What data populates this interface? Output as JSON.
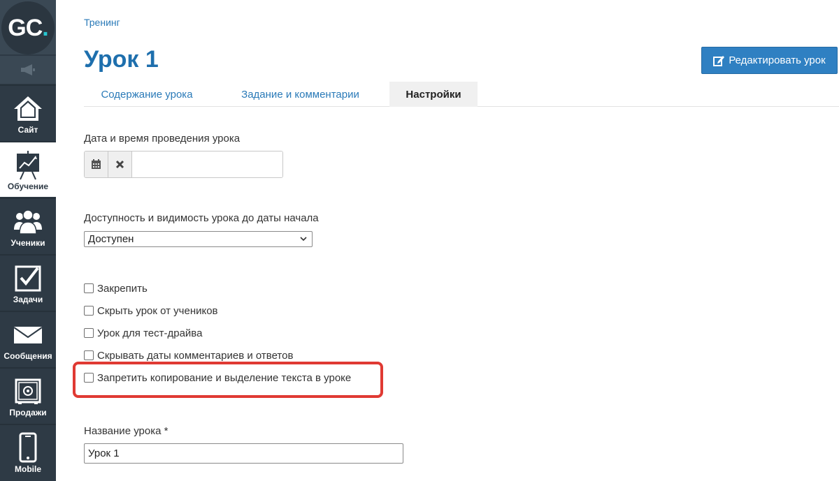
{
  "sidebar": {
    "logo": {
      "text": "GC",
      "dot": "."
    },
    "items": [
      {
        "label": "Сайт",
        "icon": "home-icon"
      },
      {
        "label": "Обучение",
        "icon": "training-chart-icon"
      },
      {
        "label": "Ученики",
        "icon": "users-icon"
      },
      {
        "label": "Задачи",
        "icon": "checkbox-icon"
      },
      {
        "label": "Сообщения",
        "icon": "envelope-icon"
      },
      {
        "label": "Продажи",
        "icon": "safe-icon"
      },
      {
        "label": "Mobile",
        "icon": "phone-icon"
      }
    ]
  },
  "header": {
    "breadcrumb": "Тренинг",
    "title": "Урок 1",
    "edit_button": "Редактировать урок"
  },
  "tabs": [
    {
      "label": "Содержание урока"
    },
    {
      "label": "Задание и комментарии"
    },
    {
      "label": "Настройки"
    }
  ],
  "form": {
    "date_label": "Дата и время проведения урока",
    "date_value": "",
    "availability_label": "Доступность и видимость урока до даты начала",
    "availability_selected": "Доступен",
    "checkboxes": [
      {
        "label": "Закрепить"
      },
      {
        "label": "Скрыть урок от учеников"
      },
      {
        "label": "Урок для тест-драйва"
      },
      {
        "label": "Скрывать даты комментариев и ответов"
      },
      {
        "label": "Запретить копирование и выделение текста в уроке"
      }
    ],
    "name_label": "Название урока *",
    "name_value": "Урок 1"
  },
  "colors": {
    "sidebar": "#2e3a45",
    "accent": "#2f80c2",
    "title": "#1e6fad",
    "highlight": "#e03a33",
    "logo_dot": "#27c6d0"
  }
}
